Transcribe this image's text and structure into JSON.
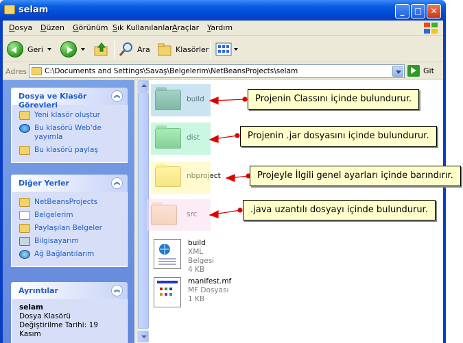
{
  "window": {
    "title": "selam"
  },
  "menu": {
    "items": [
      {
        "pre": "",
        "u": "D",
        "post": "osya"
      },
      {
        "pre": "",
        "u": "D",
        "post": "üzen"
      },
      {
        "pre": "",
        "u": "G",
        "post": "örünüm"
      },
      {
        "pre": "",
        "u": "S",
        "post": "ık Kullanılanlar"
      },
      {
        "pre": "",
        "u": "A",
        "post": "raçlar"
      },
      {
        "pre": "",
        "u": "Y",
        "post": "ardım"
      }
    ]
  },
  "toolbar": {
    "back": "Geri",
    "search": "Ara",
    "folders": "Klasörler"
  },
  "address": {
    "label": "Adres",
    "path": "C:\\Documents and Settings\\Savaş\\Belgelerim\\NetBeansProjects\\selam",
    "go": "Git"
  },
  "tasks_panel": {
    "title": "Dosya ve Klasör Görevleri",
    "items": [
      "Yeni klasör oluştur",
      "Bu klasörü Web'de yayımla",
      "Bu klasörü paylaş"
    ]
  },
  "places_panel": {
    "title": "Diğer Yerler",
    "items": [
      "NetBeansProjects",
      "Belgelerim",
      "Paylaşılan Belgeler",
      "Bilgisayarım",
      "Ağ Bağlantılarım"
    ]
  },
  "details_panel": {
    "title": "Ayrıntılar",
    "name": "selam",
    "type": "Dosya Klasörü",
    "modified": "Değiştirilme Tarihi: 19 Kasım"
  },
  "files": [
    {
      "name": "build",
      "color": "#9ed0e6"
    },
    {
      "name": "dist",
      "color": "#9ef0c8"
    },
    {
      "name": "nbproject",
      "color": "#fff5a8"
    },
    {
      "name": "src",
      "color": "#f8dcec"
    }
  ],
  "docs": [
    {
      "name": "build",
      "type": "XML Belgesi",
      "size": "4 KB"
    },
    {
      "name": "manifest.mf",
      "type": "MF Dosyası",
      "size": "1 KB"
    }
  ],
  "callouts": [
    "Projenin Classını içinde bulundurur.",
    "Projenin .jar dosyasını içinde bulundurur.",
    "Projeyle İlgili genel ayarları içinde barındırır.",
    ".java uzantılı dosyayı içinde bulundurur."
  ],
  "colors": {
    "titlebar": "#0a5fe0",
    "task_text": "#215dc6",
    "callout_bg": "#ffffcc",
    "arrow": "#e00000"
  }
}
